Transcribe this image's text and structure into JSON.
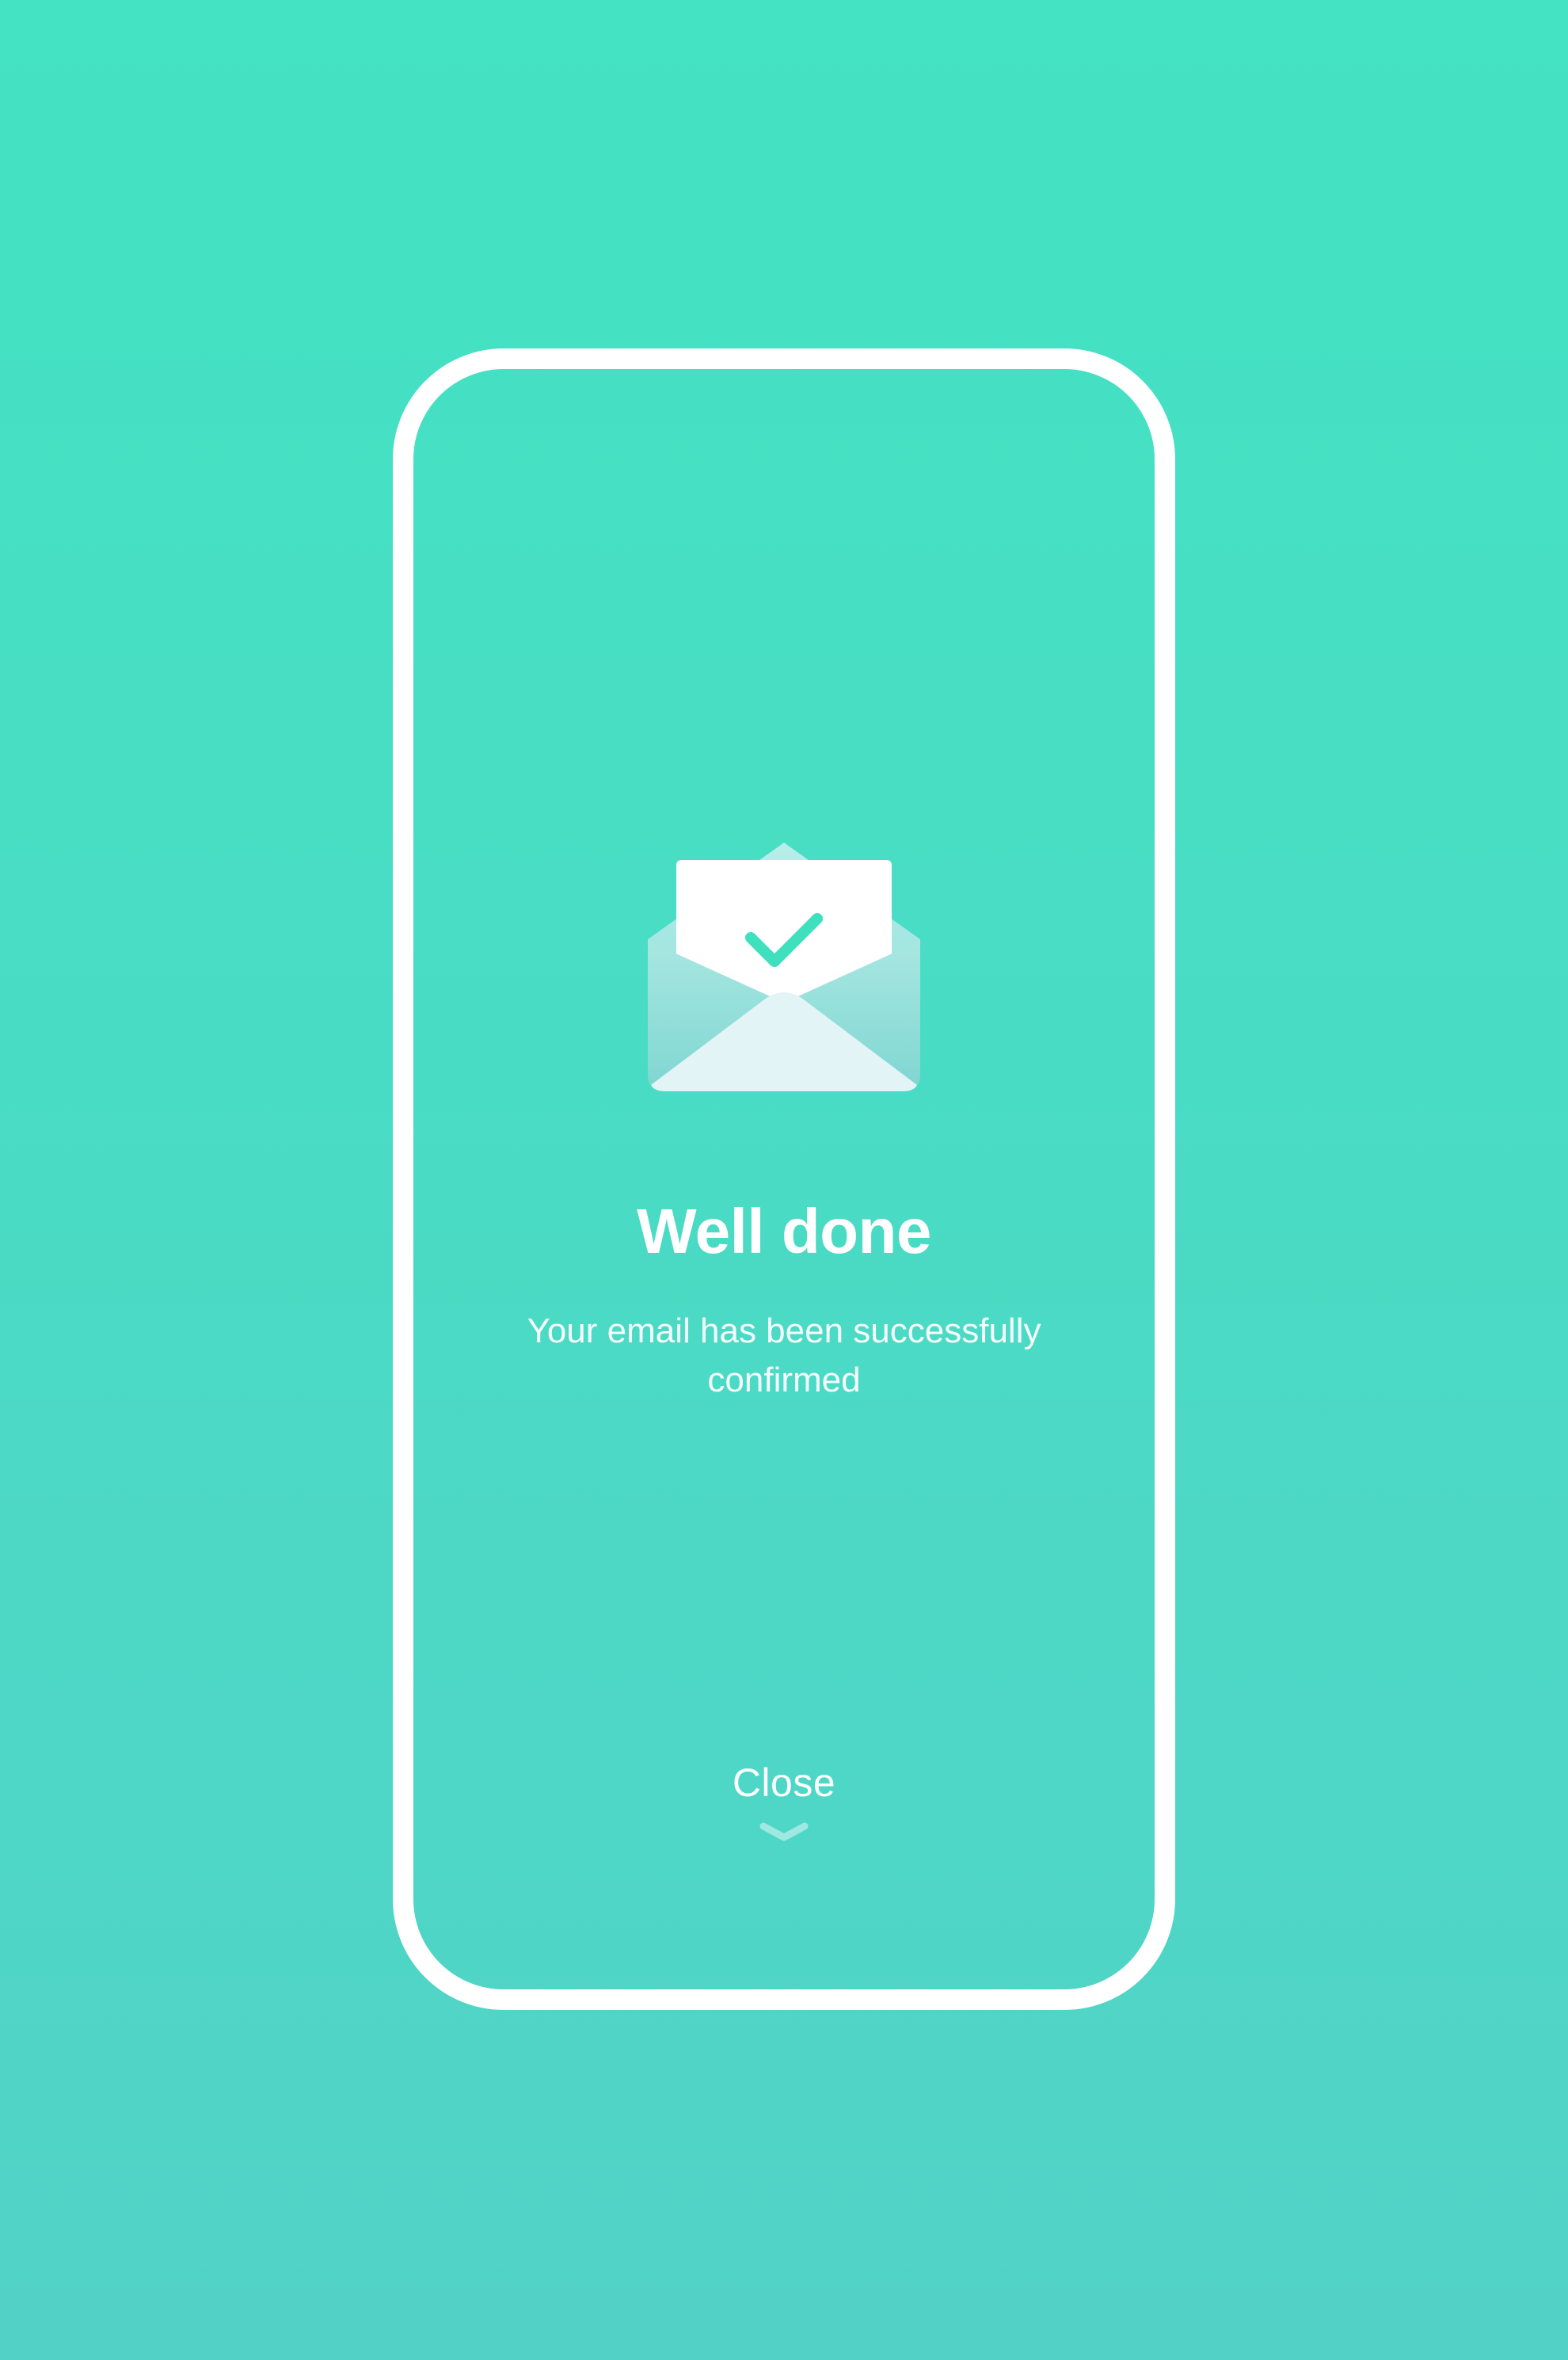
{
  "colors": {
    "background_top": "#43e3c3",
    "background_bottom": "#52d2c7",
    "frame": "#ffffff",
    "check": "#3fe0be",
    "envelope": "#e6f6f6",
    "envelope_shade": "#8fdcd7"
  },
  "illustration": {
    "icon": "email-confirmed-icon"
  },
  "confirmation": {
    "title": "Well done",
    "message": "Your email has been successfully confirmed"
  },
  "actions": {
    "close_label": "Close",
    "close_icon": "chevron-down-icon"
  }
}
